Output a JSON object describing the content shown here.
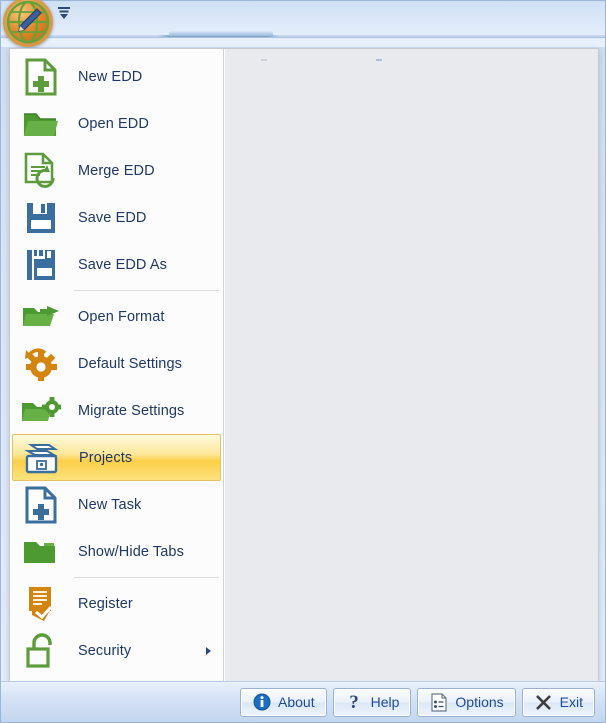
{
  "window": {
    "app_orb_name": "application-orb",
    "quick_access_name": "quick-access-toolbar-dropdown"
  },
  "menu": {
    "items": [
      {
        "label": "New EDD",
        "icon": "new-document-green-icon",
        "selected": false,
        "submenu": false,
        "separator_after": false
      },
      {
        "label": "Open EDD",
        "icon": "open-folder-green-icon",
        "selected": false,
        "submenu": false,
        "separator_after": false
      },
      {
        "label": "Merge EDD",
        "icon": "merge-document-icon",
        "selected": false,
        "submenu": false,
        "separator_after": false
      },
      {
        "label": "Save EDD",
        "icon": "save-floppy-icon",
        "selected": false,
        "submenu": false,
        "separator_after": false
      },
      {
        "label": "Save EDD As",
        "icon": "save-as-floppy-icon",
        "selected": false,
        "submenu": false,
        "separator_after": true
      },
      {
        "label": "Open Format",
        "icon": "open-format-folder-icon",
        "selected": false,
        "submenu": false,
        "separator_after": false
      },
      {
        "label": "Default Settings",
        "icon": "gear-refresh-orange-icon",
        "selected": false,
        "submenu": false,
        "separator_after": false
      },
      {
        "label": "Migrate Settings",
        "icon": "folder-gear-icon",
        "selected": false,
        "submenu": false,
        "separator_after": false
      },
      {
        "label": "Projects",
        "icon": "file-drawer-icon",
        "selected": true,
        "submenu": false,
        "separator_after": false
      },
      {
        "label": "New Task",
        "icon": "new-task-document-icon",
        "selected": false,
        "submenu": false,
        "separator_after": false
      },
      {
        "label": "Show/Hide Tabs",
        "icon": "folder-green-icon",
        "selected": false,
        "submenu": false,
        "separator_after": true
      },
      {
        "label": "Register",
        "icon": "register-checklist-icon",
        "selected": false,
        "submenu": false,
        "separator_after": false
      },
      {
        "label": "Security",
        "icon": "unlocked-padlock-icon",
        "selected": false,
        "submenu": true,
        "separator_after": false
      }
    ]
  },
  "footer": {
    "buttons": [
      {
        "label": "About",
        "icon": "info-circle-icon"
      },
      {
        "label": "Help",
        "icon": "question-mark-icon"
      },
      {
        "label": "Options",
        "icon": "options-list-icon"
      },
      {
        "label": "Exit",
        "icon": "close-x-icon"
      }
    ]
  },
  "colors": {
    "menu_text": "#1f3864",
    "highlight_start": "#fefbe0",
    "highlight_end": "#fde27e",
    "button_text": "#1f4b9b",
    "icon_green": "#5c9c3d",
    "icon_blue": "#3a6e9f",
    "icon_orange": "#d4850f"
  }
}
